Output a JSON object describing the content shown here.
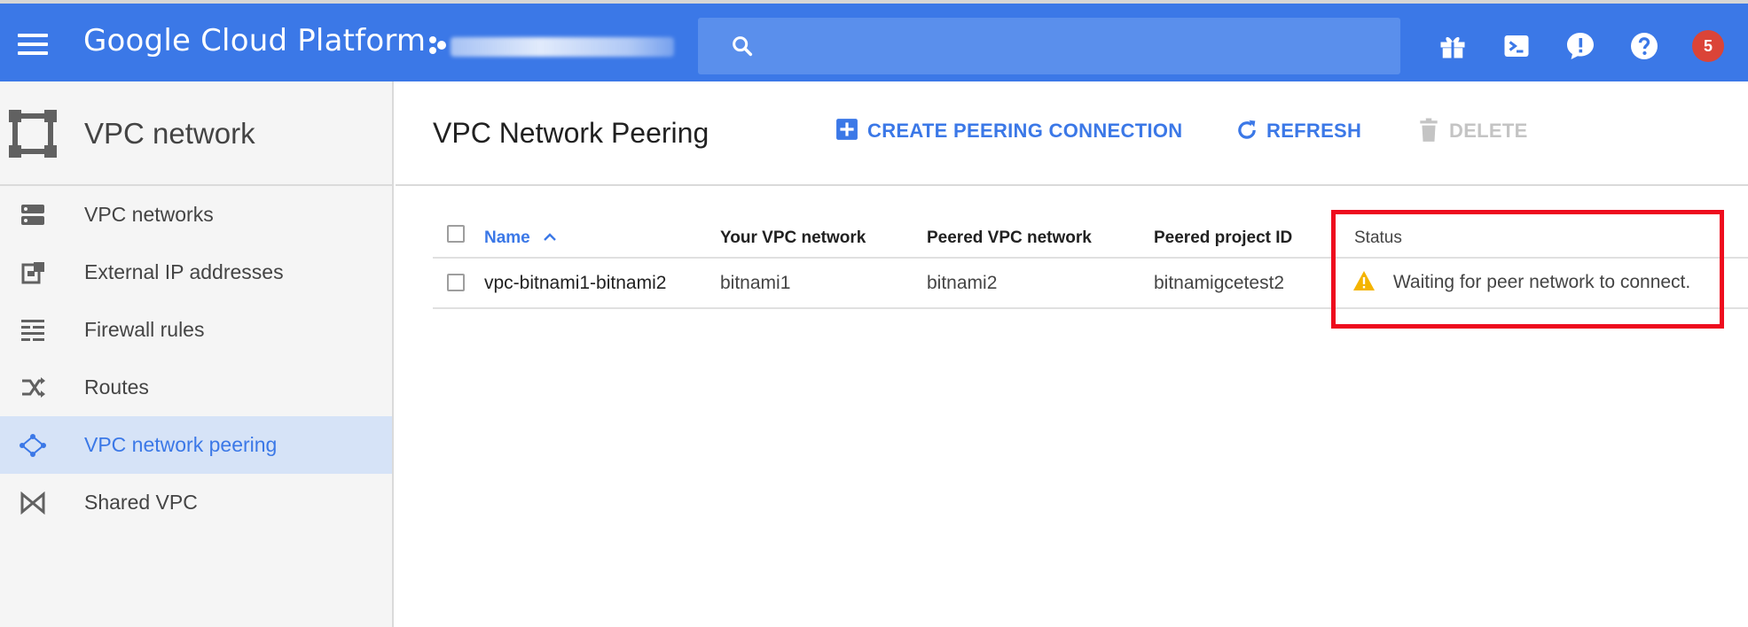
{
  "topbar": {
    "brand": "Google Cloud Platform",
    "search_placeholder": "",
    "notifications_count": "5"
  },
  "sidebar": {
    "title": "VPC network",
    "items": [
      {
        "label": "VPC networks",
        "icon": "vpc-networks-icon"
      },
      {
        "label": "External IP addresses",
        "icon": "external-ip-icon"
      },
      {
        "label": "Firewall rules",
        "icon": "firewall-icon"
      },
      {
        "label": "Routes",
        "icon": "routes-icon"
      },
      {
        "label": "VPC network peering",
        "icon": "peering-icon",
        "active": true
      },
      {
        "label": "Shared VPC",
        "icon": "shared-vpc-icon"
      }
    ]
  },
  "main": {
    "title": "VPC Network Peering",
    "actions": {
      "create": "CREATE PEERING CONNECTION",
      "refresh": "REFRESH",
      "delete": "DELETE"
    },
    "table": {
      "columns": {
        "name": "Name",
        "your_vpc": "Your VPC network",
        "peered_vpc": "Peered VPC network",
        "peered_project": "Peered project ID",
        "status": "Status"
      },
      "rows": [
        {
          "name": "vpc-bitnami1-bitnami2",
          "your_vpc": "bitnami1",
          "peered_vpc": "bitnami2",
          "peered_project": "bitnamigcetest2",
          "status": "Waiting for peer network to connect."
        }
      ]
    }
  },
  "colors": {
    "topbar": "#3b78e7",
    "accent": "#3b78e7",
    "warning": "#f4b400",
    "highlight": "#ee0c1e",
    "badge": "#db4437"
  }
}
